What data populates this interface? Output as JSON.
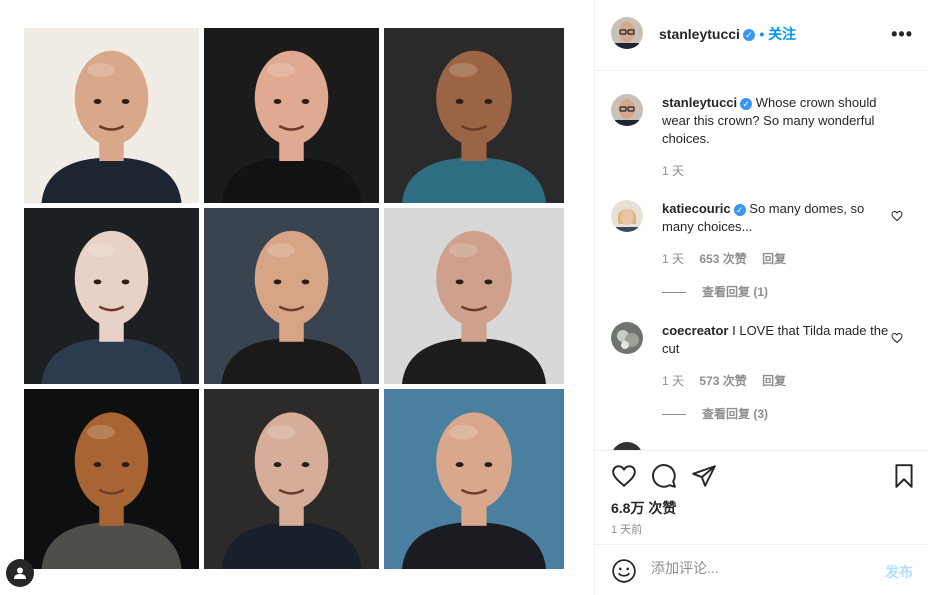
{
  "post": {
    "author": "stanleytucci",
    "follow_label": "• 关注",
    "more_label": "•••",
    "grid_items": [
      {
        "name": "stanley-tucci",
        "bg": "#f2ece6",
        "skin": "#d9a88a",
        "shirt": "#1d2530"
      },
      {
        "name": "bruce-willis",
        "bg": "#1b1b1b",
        "skin": "#e0a991",
        "shirt": "#121212"
      },
      {
        "name": "dwayne-johnson",
        "bg": "#2a2a2a",
        "skin": "#9b6545",
        "shirt": "#2f6e82"
      },
      {
        "name": "tilda-swinton",
        "bg": "#1c2022",
        "skin": "#e8d1c6",
        "shirt": "#2d3b4e"
      },
      {
        "name": "jason-statham",
        "bg": "#3a4450",
        "skin": "#d7a586",
        "shirt": "#1a1a1a"
      },
      {
        "name": "patrick-stewart",
        "bg": "#d8d8d8",
        "skin": "#cfa08c",
        "shirt": "#1d1d1d"
      },
      {
        "name": "ll-cool-j",
        "bg": "#0e0f10",
        "skin": "#a86432",
        "shirt": "#4e4e4a"
      },
      {
        "name": "mark-strong",
        "bg": "#2d2b29",
        "skin": "#d6ad98",
        "shirt": "#1a1f2c"
      },
      {
        "name": "ryan-reynolds",
        "bg": "#4a7fa0",
        "skin": "#d9a88c",
        "shirt": "#1b1c22"
      }
    ]
  },
  "caption": {
    "username": "stanleytucci",
    "text": "Whose crown should wear this crown? So many wonderful choices.",
    "time": "1 天"
  },
  "comments": [
    {
      "username": "katiecouric",
      "verified": true,
      "text": "So many domes, so many choices...",
      "time": "1 天",
      "likes": "653 次赞",
      "reply": "回复",
      "view_replies": "查看回复 (1)"
    },
    {
      "username": "coecreator",
      "verified": false,
      "text": "I LOVE that Tilda made the cut",
      "time": "1 天",
      "likes": "573 次赞",
      "reply": "回复",
      "view_replies": "查看回复 (3)"
    }
  ],
  "stats": {
    "likes": "6.8万 次赞",
    "date": "1 天前"
  },
  "comment_box": {
    "placeholder": "添加评论...",
    "post_label": "发布"
  },
  "colors": {
    "accent": "#0095f6",
    "verified": "#3897f0",
    "muted": "#8e8e8e",
    "border": "#efefef"
  }
}
